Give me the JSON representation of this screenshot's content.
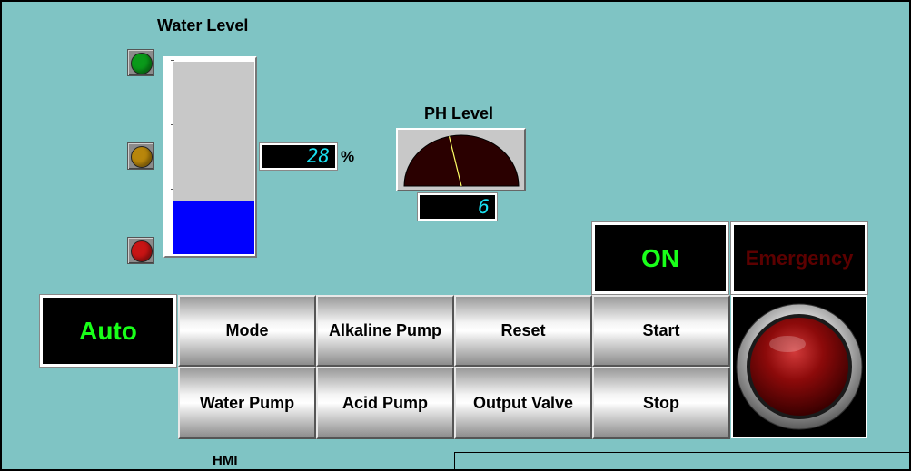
{
  "water_level": {
    "title": "Water Level",
    "percent_value": "28",
    "percent_unit": "%",
    "fill_fraction": 0.28,
    "indicators": [
      {
        "name": "high",
        "color": "#0a9a1a"
      },
      {
        "name": "mid",
        "color": "#b8860b"
      },
      {
        "name": "low",
        "color": "#c81414"
      }
    ]
  },
  "ph_level": {
    "title": "PH Level",
    "value": "6",
    "gauge_fraction": 0.43,
    "gauge_color": "#2a0000",
    "needle_color": "#ffff66"
  },
  "status": {
    "run_state": "ON",
    "run_color": "#19ff19",
    "emergency_label": "Emergency",
    "emergency_color": "#5c0000",
    "mode_state": "Auto",
    "mode_color": "#19ff19"
  },
  "buttons": {
    "mode": "Mode",
    "alkaline_pump": "Alkaline Pump",
    "reset": "Reset",
    "start": "Start",
    "water_pump": "Water Pump",
    "acid_pump": "Acid Pump",
    "output_valve": "Output Valve",
    "stop": "Stop"
  },
  "footer": {
    "label": "HMI"
  },
  "icons": {
    "emergency_stop": "emergency-stop-icon"
  }
}
